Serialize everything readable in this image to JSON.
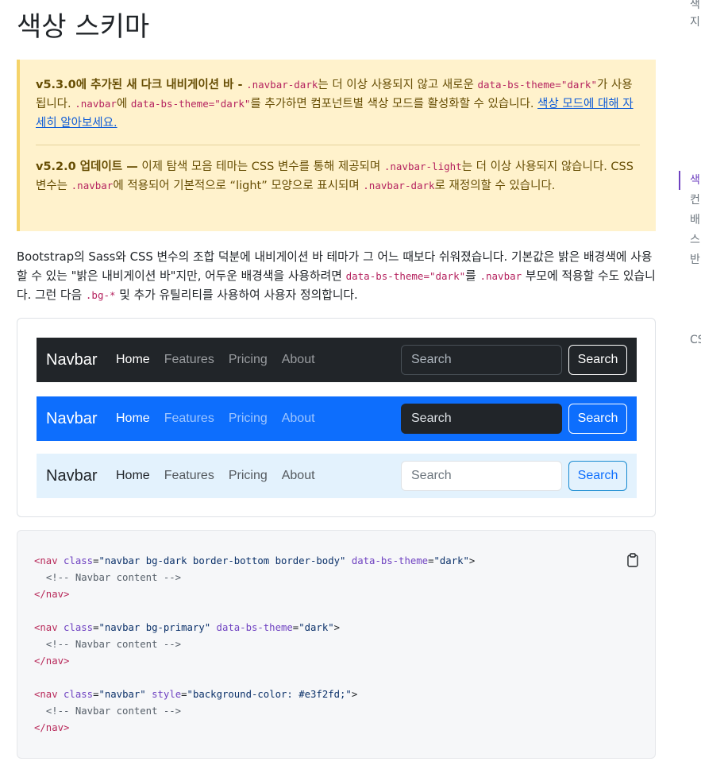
{
  "page_title": "색상 스키마",
  "callout": {
    "p1_strong": "v5.3.0에 추가된 새 다크 내비게이션 바 -",
    "p1_code1": ".navbar-dark",
    "p1_text1": "는 더 이상 사용되지 않고 새로운",
    "p1_code2": "data-bs-theme=\"dark\"",
    "p1_text2": "가 사용됩니다.",
    "p1_code3": ".navbar",
    "p1_text3": "에",
    "p1_code4": "data-bs-theme=\"dark\"",
    "p1_text4": "를 추가하면 컴포넌트별 색상 모드를 활성화할 수 있습니다.",
    "p1_link": "색상 모드에 대해 자세히 알아보세요.",
    "p2_strong": "v5.2.0 업데이트 —",
    "p2_text1": "이제 탐색 모음 테마는 CSS 변수를 통해 제공되며",
    "p2_code1": ".navbar-light",
    "p2_text2": "는 더 이상 사용되지 않습니다. CSS 변수는",
    "p2_code2": ".navbar",
    "p2_text3": "에 적용되어 기본적으로 “light” 모양으로 표시되며",
    "p2_code3": ".navbar-dark",
    "p2_text4": "로 재정의할 수 있습니다."
  },
  "lead": {
    "text1": "Bootstrap의 Sass와 CSS 변수의 조합 덕분에 내비게이션 바 테마가 그 어느 때보다 쉬워졌습니다. 기본값은 밝은 배경색에 사용할 수 있는 \"밝은 내비게이션 바\"지만, 어두운 배경색을 사용하려면",
    "code1": "data-bs-theme=\"dark\"",
    "text2": "를",
    "code2": ".navbar",
    "text3": "부모에 적용할 수도 있습니다. 그런 다음",
    "code3": ".bg-*",
    "text4": "및 추가 유틸리티를 사용하여 사용자 정의합니다."
  },
  "navbars": [
    {
      "brand": "Navbar",
      "links": [
        "Home",
        "Features",
        "Pricing",
        "About"
      ],
      "placeholder": "Search",
      "button": "Search"
    },
    {
      "brand": "Navbar",
      "links": [
        "Home",
        "Features",
        "Pricing",
        "About"
      ],
      "placeholder": "Search",
      "button": "Search"
    },
    {
      "brand": "Navbar",
      "links": [
        "Home",
        "Features",
        "Pricing",
        "About"
      ],
      "placeholder": "Search",
      "button": "Search"
    }
  ],
  "code": {
    "nav_open": "<nav",
    "nav_close": "</nav>",
    "tag_end": ">",
    "class_attr": "class",
    "eq": "=",
    "comment": "<!-- Navbar content -->",
    "b1_class": "\"navbar bg-dark border-bottom border-body\"",
    "b1_attr": "data-bs-theme",
    "b1_val": "\"dark\"",
    "b2_class": "\"navbar bg-primary\"",
    "b2_attr": "data-bs-theme",
    "b2_val": "\"dark\"",
    "b3_class": "\"navbar\"",
    "b3_attr": "style",
    "b3_val": "\"background-color: #e3f2fd;\""
  },
  "toc": [
    "색",
    "지",
    "색",
    "컨",
    "배",
    "스",
    "반",
    "CS"
  ],
  "colors": {
    "accent": "#6f42c1",
    "primary": "#0d6efd",
    "dark": "#212529",
    "light_navbar": "#e3f2fd",
    "callout_bg": "#fff2cc"
  }
}
